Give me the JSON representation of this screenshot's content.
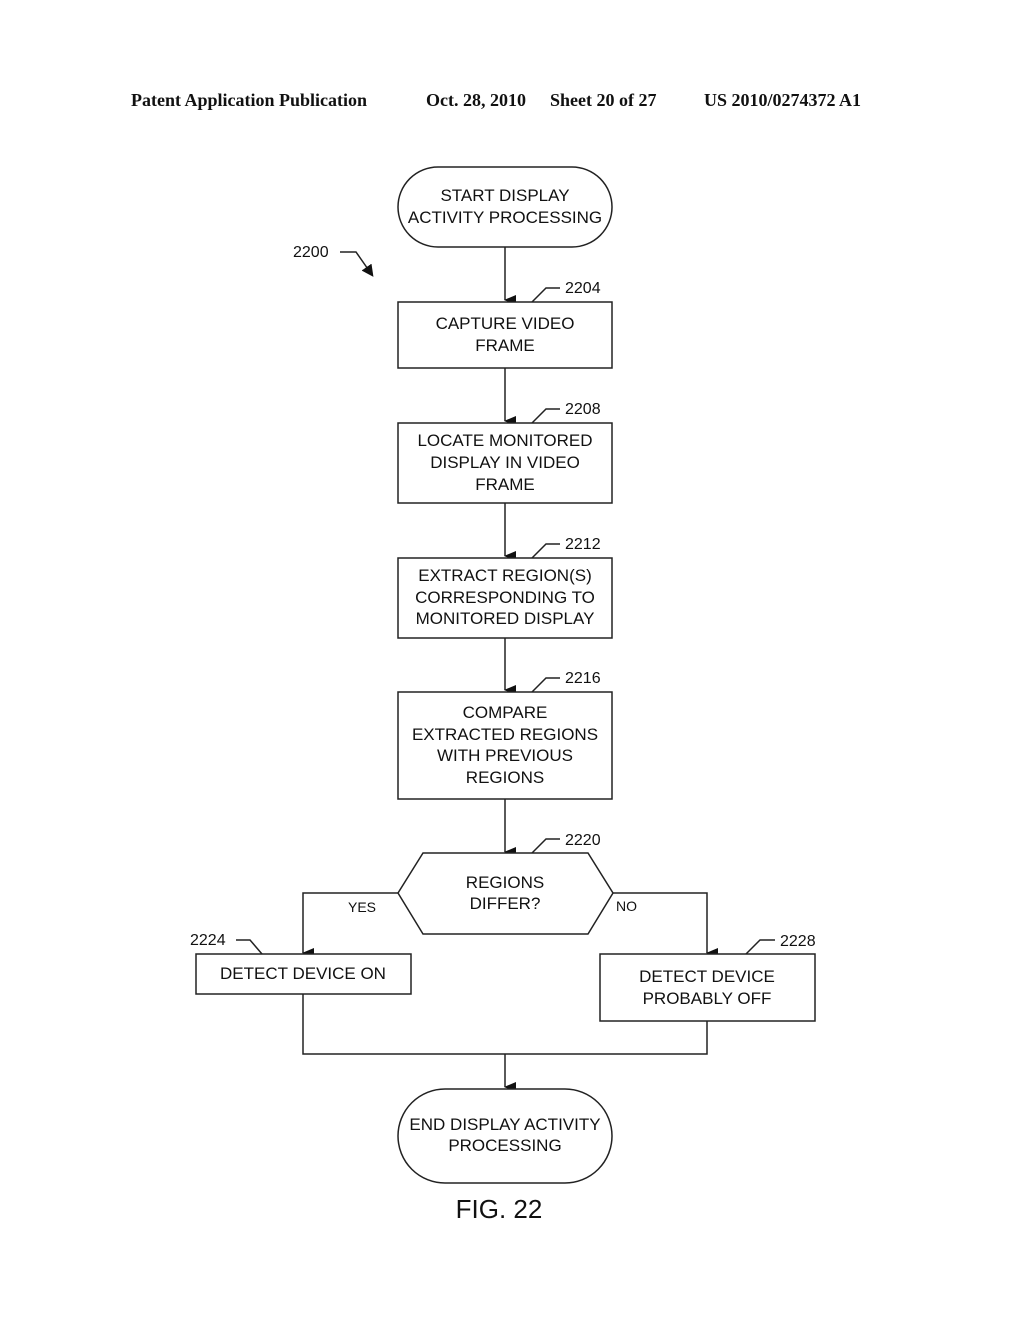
{
  "header": {
    "publication": "Patent Application Publication",
    "date": "Oct. 28, 2010",
    "sheet": "Sheet 20 of 27",
    "number": "US 2010/0274372 A1"
  },
  "figure": {
    "ref": "2200",
    "caption": "FIG. 22"
  },
  "nodes": {
    "start": {
      "type": "terminal",
      "lines": [
        "START DISPLAY",
        "ACTIVITY PROCESSING"
      ]
    },
    "capture": {
      "ref": "2204",
      "type": "process",
      "lines": [
        "CAPTURE VIDEO",
        "FRAME"
      ]
    },
    "locate": {
      "ref": "2208",
      "type": "process",
      "lines": [
        "LOCATE MONITORED",
        "DISPLAY IN VIDEO",
        "FRAME"
      ]
    },
    "extract": {
      "ref": "2212",
      "type": "process",
      "lines": [
        "EXTRACT REGION(S)",
        "CORRESPONDING TO",
        "MONITORED DISPLAY"
      ]
    },
    "compare": {
      "ref": "2216",
      "type": "process",
      "lines": [
        "COMPARE",
        "EXTRACTED REGIONS",
        "WITH PREVIOUS",
        "REGIONS"
      ]
    },
    "decision": {
      "ref": "2220",
      "type": "decision",
      "lines": [
        "REGIONS",
        "DIFFER?"
      ]
    },
    "on": {
      "ref": "2224",
      "type": "process",
      "lines": [
        "DETECT DEVICE ON"
      ]
    },
    "off": {
      "ref": "2228",
      "type": "process",
      "lines": [
        "DETECT DEVICE",
        "PROBABLY OFF"
      ]
    },
    "end": {
      "type": "terminal",
      "lines": [
        "END DISPLAY ACTIVITY",
        "PROCESSING"
      ]
    }
  },
  "edges": {
    "yes_label": "YES",
    "no_label": "NO"
  }
}
